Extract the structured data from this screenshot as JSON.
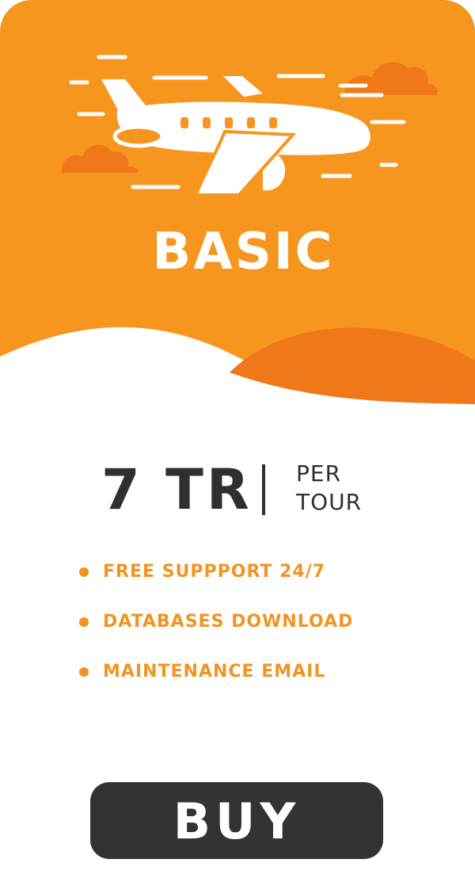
{
  "plan": {
    "name": "BASIC",
    "illustration": "airplane-icon"
  },
  "price": {
    "amount": "7 TR",
    "unit_line1": "PER",
    "unit_line2": "TOUR"
  },
  "features": [
    {
      "label": "FREE SUPPPORT 24/7"
    },
    {
      "label": "DATABASES DOWNLOAD"
    },
    {
      "label": "MAINTENANCE EMAIL"
    }
  ],
  "buy_button": {
    "label": "BUY"
  },
  "colors": {
    "accent": "#F7961F",
    "accent_dark": "#F07818",
    "text_dark": "#2F2F2F",
    "button_bg": "#333333",
    "background": "#FFFFFF"
  }
}
